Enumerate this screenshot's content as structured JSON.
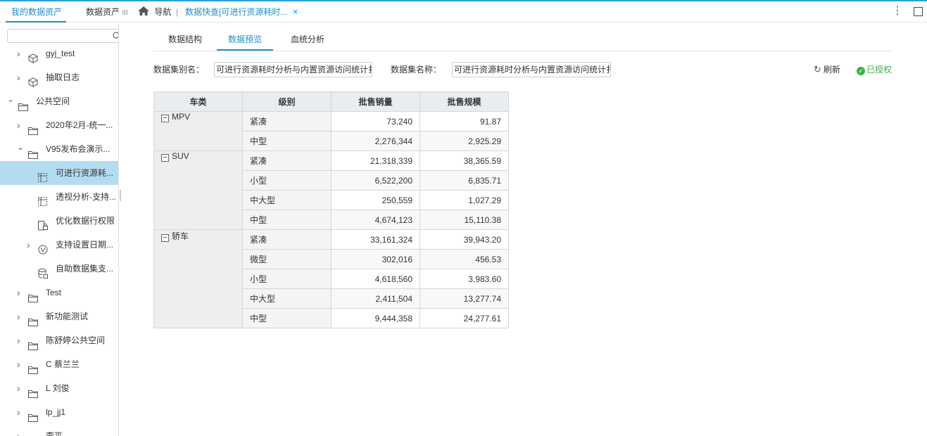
{
  "tabs": {
    "my_assets": "我的数据资产",
    "data_assets": "数据资产",
    "data_assets_more": "III",
    "nav": "导航",
    "current": "数据快查[可进行资源耗时...",
    "close": "×"
  },
  "sidebar": {
    "search_placeholder": "",
    "items": [
      {
        "label": "gyj_test",
        "icon": "cube-icon",
        "indent": 1
      },
      {
        "label": "抽取日志",
        "icon": "cube-icon",
        "indent": 1
      },
      {
        "label": "公共空间",
        "icon": "folder-icon",
        "indent": 0
      },
      {
        "label": "2020年2月-统一...",
        "icon": "folder-icon",
        "indent": 1
      },
      {
        "label": "V95发布会演示...",
        "icon": "folder-icon",
        "indent": 1
      },
      {
        "label": "可进行资源耗...",
        "icon": "pivot-icon",
        "indent": 2
      },
      {
        "label": "透视分析-支持...",
        "icon": "pivot-icon",
        "indent": 2
      },
      {
        "label": "优化数据行权限",
        "icon": "doc-lock-icon",
        "indent": 2
      },
      {
        "label": "支持设置日期...",
        "icon": "query-icon",
        "indent": 2
      },
      {
        "label": "自助数据集支...",
        "icon": "dataset-icon",
        "indent": 2
      },
      {
        "label": "Test",
        "icon": "folder-icon",
        "indent": 1
      },
      {
        "label": "新功能测试",
        "icon": "folder-icon",
        "indent": 1
      },
      {
        "label": "陈舒婷公共空间",
        "icon": "folder-icon",
        "indent": 1
      },
      {
        "label": "C 蔡兰兰",
        "icon": "folder-icon",
        "indent": 1
      },
      {
        "label": "L 刘俊",
        "icon": "folder-icon",
        "indent": 1
      },
      {
        "label": "lp_jj1",
        "icon": "folder-icon",
        "indent": 1
      },
      {
        "label": "李平",
        "icon": "folder-icon",
        "indent": 1
      }
    ]
  },
  "subtabs": [
    "数据结构",
    "数据预览",
    "血统分析"
  ],
  "fields": {
    "alias_label": "数据集别名：",
    "alias_value": "可进行资源耗时分析与内置资源访问统计扌",
    "name_label": "数据集名称：",
    "name_value": "可进行资源耗时分析与内置资源访问统计扌"
  },
  "actions": {
    "refresh": "刷新",
    "authorized": "已授权"
  },
  "table": {
    "headers": [
      "车类",
      "级别",
      "批售销量",
      "批售规模"
    ],
    "groups": [
      {
        "name": "MPV",
        "rows": [
          [
            "紧凑",
            "73,240",
            "91.87"
          ],
          [
            "中型",
            "2,276,344",
            "2,925.29"
          ]
        ]
      },
      {
        "name": "SUV",
        "rows": [
          [
            "紧凑",
            "21,318,339",
            "38,365.59"
          ],
          [
            "小型",
            "6,522,200",
            "6,835.71"
          ],
          [
            "中大型",
            "250,559",
            "1,027.29"
          ],
          [
            "中型",
            "4,674,123",
            "15,110.38"
          ]
        ]
      },
      {
        "name": "轿车",
        "rows": [
          [
            "紧凑",
            "33,161,324",
            "39,943.20"
          ],
          [
            "微型",
            "302,016",
            "456.53"
          ],
          [
            "小型",
            "4,618,560",
            "3,983.60"
          ],
          [
            "中大型",
            "2,411,504",
            "13,277.74"
          ],
          [
            "中型",
            "9,444,358",
            "24,277.61"
          ]
        ]
      }
    ]
  },
  "colors": {
    "accent": "#1a8fd1",
    "selected_row": "#b3dcf0",
    "authorized": "#3bb24b"
  }
}
